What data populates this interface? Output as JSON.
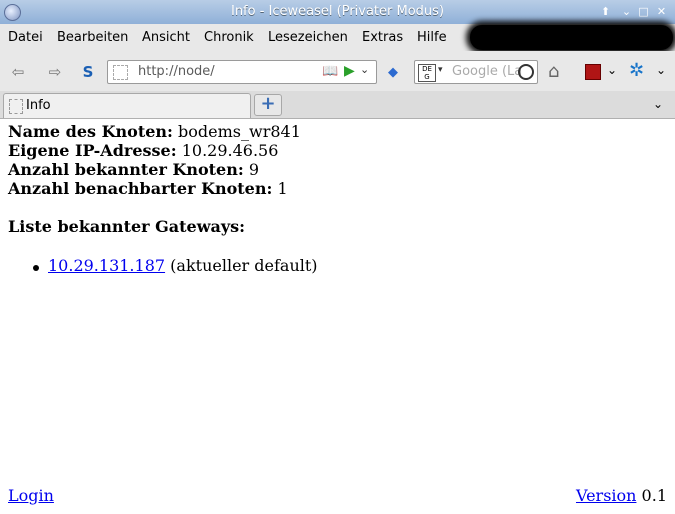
{
  "window": {
    "title": "Info - Iceweasel (Privater Modus)"
  },
  "menu": {
    "items": [
      {
        "label": "Datei"
      },
      {
        "label": "Bearbeiten"
      },
      {
        "label": "Ansicht"
      },
      {
        "label": "Chronik"
      },
      {
        "label": "Lesezeichen"
      },
      {
        "label": "Extras"
      },
      {
        "label": "Hilfe"
      }
    ]
  },
  "nav": {
    "url": "http://node/",
    "search_placeholder": "Google (La"
  },
  "tabs": [
    {
      "label": "Info"
    }
  ],
  "page": {
    "fields": [
      {
        "label": "Name des Knoten:",
        "value": "bodems_wr841"
      },
      {
        "label": "Eigene IP-Adresse:",
        "value": "10.29.46.56"
      },
      {
        "label": "Anzahl bekannter Knoten:",
        "value": "9"
      },
      {
        "label": "Anzahl benachbarter Knoten:",
        "value": "1"
      }
    ],
    "gateways_heading": "Liste bekannter Gateways:",
    "gateways": [
      {
        "address": "10.29.131.187",
        "note": "(aktueller default)"
      }
    ],
    "login_link": "Login",
    "version_link": "Version",
    "version_number": "0.1"
  },
  "colors": {
    "link": "#0000ee",
    "titlebar": "#8fb0d8"
  }
}
